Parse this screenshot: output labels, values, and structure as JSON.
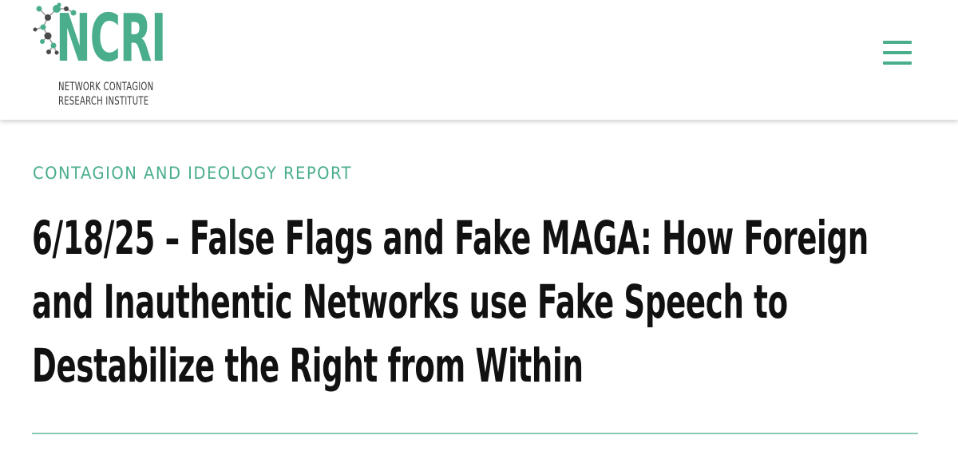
{
  "brand": {
    "logo_mark": "NCRI",
    "logo_line1": "NETWORK CONTAGION",
    "logo_line2": "RESEARCH INSTITUTE",
    "accent_color": "#4aae8c"
  },
  "header": {
    "menu_icon": "hamburger-menu-icon"
  },
  "article": {
    "category": "CONTAGION AND IDEOLOGY REPORT",
    "title": "6/18/25 – False Flags and Fake MAGA: How Foreign and Inauthentic Networks use Fake Speech to Destabilize the Right from Within"
  }
}
